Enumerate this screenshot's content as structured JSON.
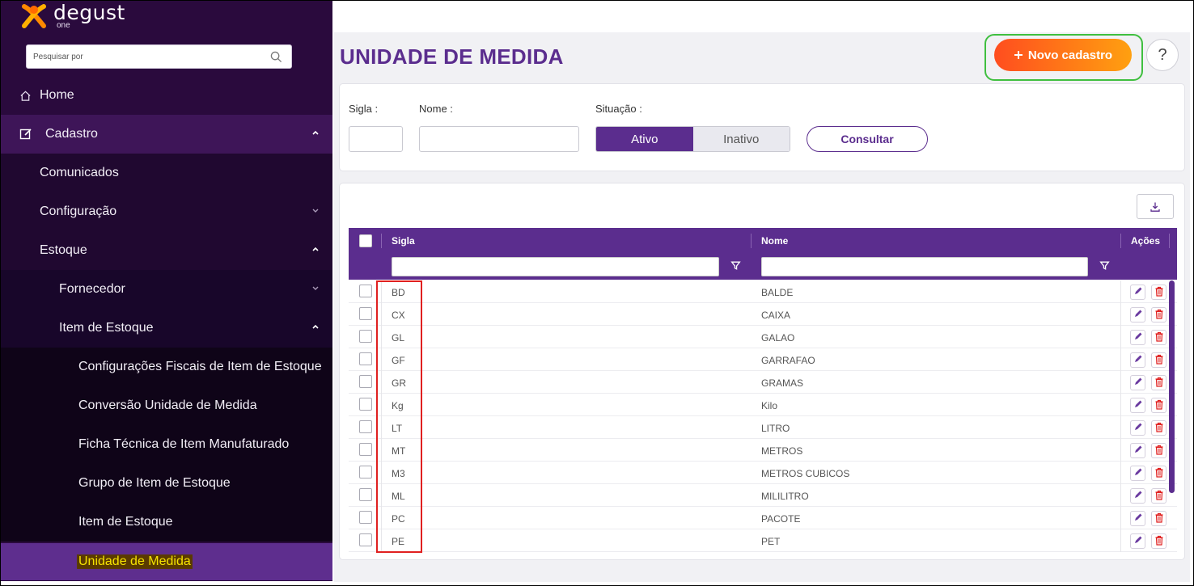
{
  "app": {
    "logo_text": "degust",
    "logo_sub": "one"
  },
  "search": {
    "placeholder": "Pesquisar por"
  },
  "sidebar": {
    "home": "Home",
    "cadastro": "Cadastro",
    "comunicados": "Comunicados",
    "configuracao": "Configuração",
    "estoque": "Estoque",
    "fornecedor": "Fornecedor",
    "item_estoque": "Item de Estoque",
    "sub_items": [
      "Configurações Fiscais de Item de Estoque",
      "Conversão Unidade de Medida",
      "Ficha Técnica de Item Manufaturado",
      "Grupo de Item de Estoque",
      "Item de Estoque",
      "Unidade de Medida"
    ]
  },
  "header": {
    "title": "UNIDADE DE MEDIDA",
    "new_button": "Novo cadastro",
    "help": "?"
  },
  "filters": {
    "sigla_label": "Sigla :",
    "nome_label": "Nome :",
    "situacao_label": "Situação :",
    "ativo": "Ativo",
    "inativo": "Inativo",
    "consultar": "Consultar"
  },
  "grid": {
    "columns": {
      "sigla": "Sigla",
      "nome": "Nome",
      "acoes": "Ações"
    },
    "rows": [
      {
        "sigla": "BD",
        "nome": "BALDE"
      },
      {
        "sigla": "CX",
        "nome": "CAIXA"
      },
      {
        "sigla": "GL",
        "nome": "GALAO"
      },
      {
        "sigla": "GF",
        "nome": "GARRAFAO"
      },
      {
        "sigla": "GR",
        "nome": "GRAMAS"
      },
      {
        "sigla": "Kg",
        "nome": "Kilo"
      },
      {
        "sigla": "LT",
        "nome": "LITRO"
      },
      {
        "sigla": "MT",
        "nome": "METROS"
      },
      {
        "sigla": "M3",
        "nome": "METROS CUBICOS"
      },
      {
        "sigla": "ML",
        "nome": "MILILITRO"
      },
      {
        "sigla": "PC",
        "nome": "PACOTE"
      },
      {
        "sigla": "PE",
        "nome": "PET"
      }
    ]
  }
}
